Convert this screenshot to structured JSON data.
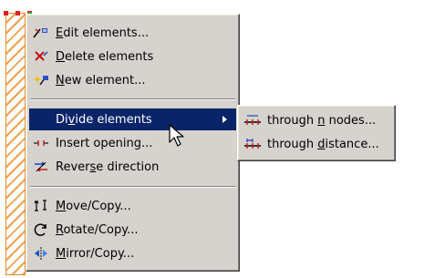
{
  "menu": {
    "items": [
      {
        "before": "",
        "key": "E",
        "after": "dit elements...",
        "icon": "edit-elements-icon"
      },
      {
        "before": "",
        "key": "D",
        "after": "elete elements",
        "icon": "delete-elements-icon"
      },
      {
        "before": "",
        "key": "N",
        "after": "ew element...",
        "icon": "new-element-icon"
      },
      {
        "before": "Di",
        "key": "v",
        "after": "ide elements",
        "icon": "",
        "has_submenu": true,
        "highlighted": true
      },
      {
        "before": "",
        "key": "",
        "after": "Insert opening...",
        "icon": "insert-opening-icon"
      },
      {
        "before": "Rever",
        "key": "s",
        "after": "e direction",
        "icon": "reverse-direction-icon"
      },
      {
        "before": "",
        "key": "M",
        "after": "ove/Copy...",
        "icon": "move-copy-icon"
      },
      {
        "before": "",
        "key": "R",
        "after": "otate/Copy...",
        "icon": "rotate-copy-icon"
      },
      {
        "before": "",
        "key": "M",
        "after": "irror/Copy...",
        "icon": "mirror-copy-icon"
      }
    ]
  },
  "submenu": {
    "items": [
      {
        "before": "through ",
        "key": "n",
        "after": " nodes...",
        "icon": "divide-nodes-icon"
      },
      {
        "before": "through ",
        "key": "d",
        "after": "istance...",
        "icon": "divide-distance-icon"
      }
    ]
  },
  "colors": {
    "menu_bg": "#d6d3ce",
    "highlight": "#0a246a",
    "hatch": "#f0a050"
  }
}
